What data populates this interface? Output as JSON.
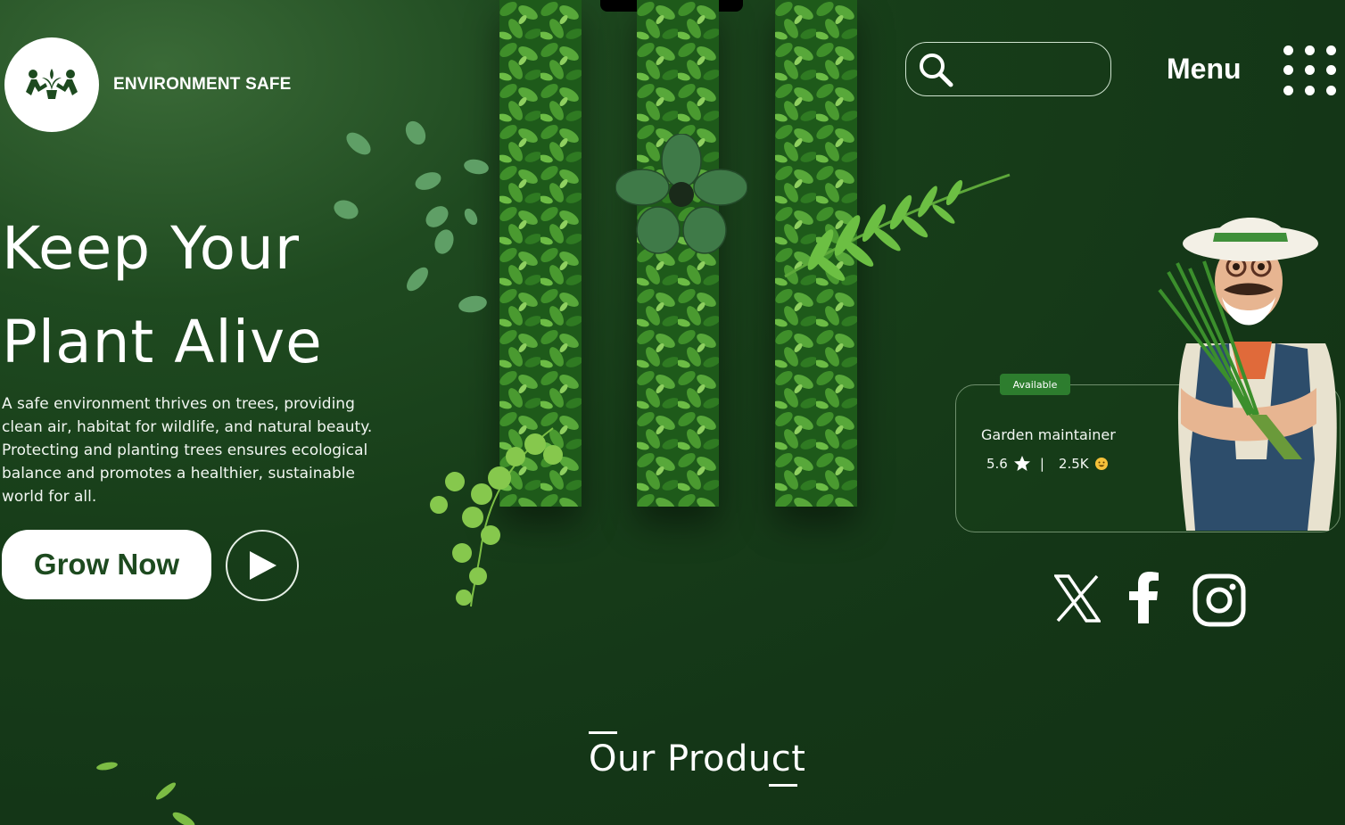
{
  "brand": {
    "name": "ENVIRONMENT SAFE"
  },
  "header": {
    "search_placeholder": "",
    "menu_label": "Menu"
  },
  "hero": {
    "title_line1": "Keep Your",
    "title_line2": "Plant Alive",
    "description": "A safe environment thrives on trees, providing clean air, habitat for wildlife, and natural beauty. Protecting and planting trees ensures ecological balance and promotes a healthier, sustainable world for all.",
    "cta_label": "Grow Now"
  },
  "profile_card": {
    "badge": "Available",
    "title": "Garden maintainer",
    "rating": "5.6",
    "separator": "|",
    "followers": "2.5K"
  },
  "social": {
    "icons": [
      "x-icon",
      "facebook-icon",
      "instagram-icon"
    ]
  },
  "section": {
    "title": "Our Product"
  },
  "colors": {
    "background": "#173d19",
    "button_text": "#1d4a1f",
    "badge": "#2d7d2e",
    "card_border": "#6f8f6d"
  }
}
